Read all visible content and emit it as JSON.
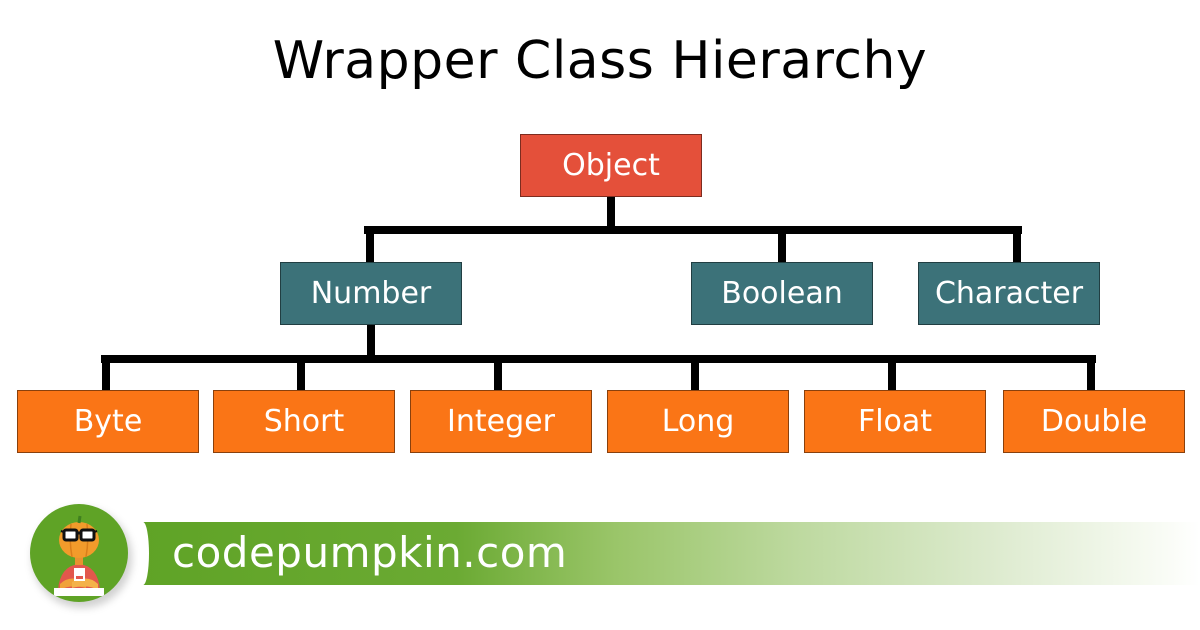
{
  "title": "Wrapper Class Hierarchy",
  "colors": {
    "root": "#E4503A",
    "mid": "#3C7279",
    "leaf": "#FA7516",
    "brand_green": "#5FA326"
  },
  "hierarchy": {
    "root": {
      "label": "Object"
    },
    "children": [
      {
        "label": "Number",
        "children": [
          {
            "label": "Byte"
          },
          {
            "label": "Short"
          },
          {
            "label": "Integer"
          },
          {
            "label": "Long"
          },
          {
            "label": "Float"
          },
          {
            "label": "Double"
          }
        ]
      },
      {
        "label": "Boolean"
      },
      {
        "label": "Character"
      }
    ]
  },
  "footer": {
    "site": "codepumpkin.com",
    "logo_icon": "pumpkin-mascot-icon"
  }
}
